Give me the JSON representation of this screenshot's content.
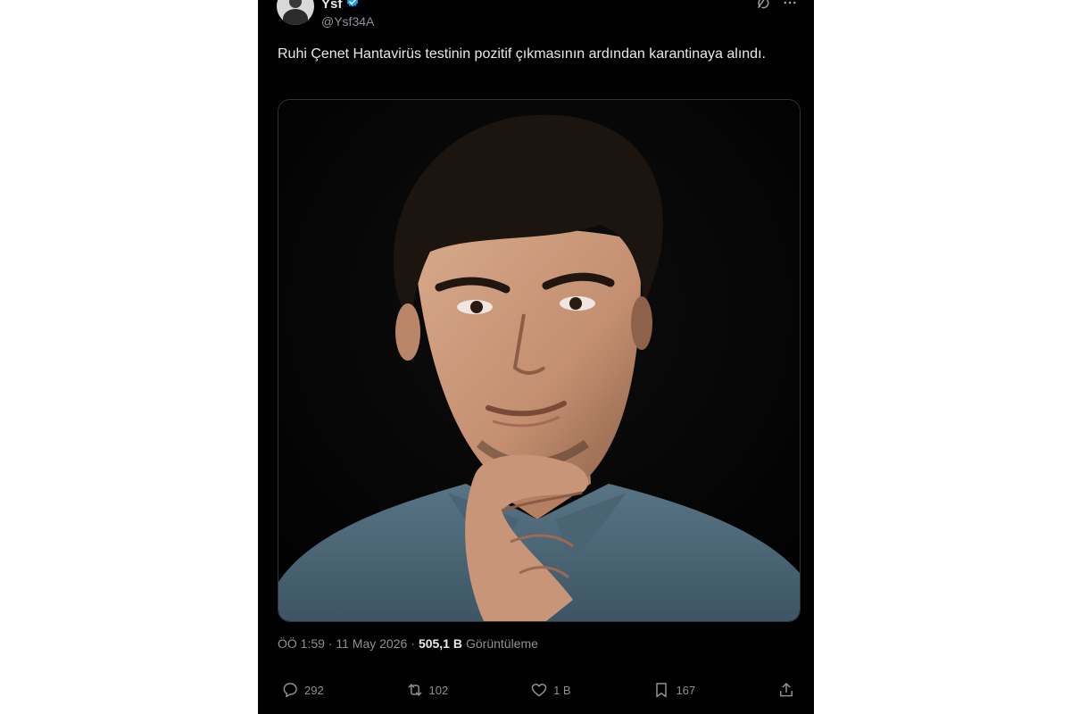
{
  "tweet": {
    "display_name": "Ysf",
    "handle": "@Ysf34A",
    "text": "Ruhi Çenet Hantavirüs testinin pozitif çıkmasının ardından karantinaya alındı.",
    "timestamp": "ÖÖ 1:59 · 11 May 2026",
    "separator": "·",
    "views_count": "505,1 B",
    "views_label": "Görüntüleme"
  },
  "actions": {
    "replies": "292",
    "reposts": "102",
    "likes": "1 B",
    "bookmarks": "167"
  },
  "colors": {
    "background": "#000000",
    "text": "#e7e9ea",
    "muted": "#8b9198",
    "verified": "#1d9bf0"
  },
  "icons": [
    "avatar",
    "verified-badge-icon",
    "grok-icon",
    "more-icon",
    "reply-icon",
    "repost-icon",
    "like-icon",
    "bookmark-icon",
    "share-icon"
  ]
}
